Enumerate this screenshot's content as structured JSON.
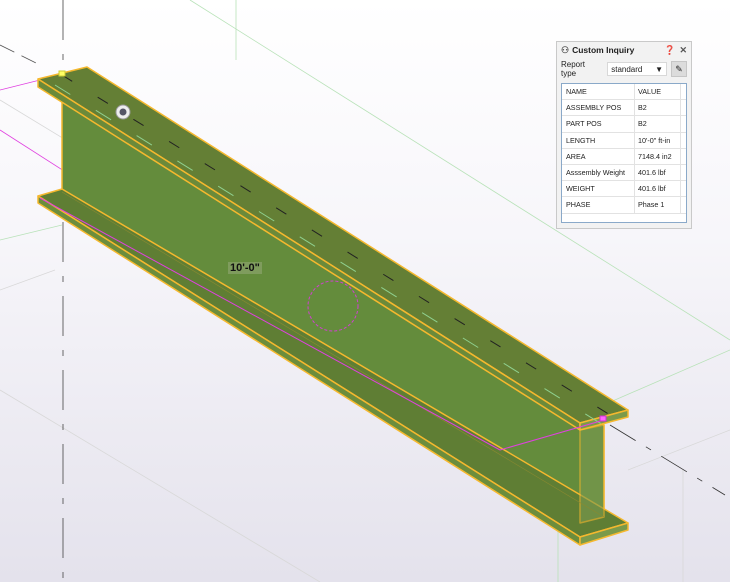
{
  "model": {
    "dimension_label": "10'-0\"",
    "beam_color": "#648a3a",
    "highlight_color": "#f5b82e"
  },
  "panel": {
    "title": "Custom Inquiry",
    "title_icon": "inquiry-icon",
    "help_icon": "help-icon",
    "close_icon": "close-icon",
    "report_type_label": "Report type",
    "report_type_value": "standard",
    "columns": [
      "NAME",
      "VALUE"
    ],
    "rows": [
      {
        "name": "ASSEMBLY POS",
        "value": "B2"
      },
      {
        "name": "PART POS",
        "value": "B2"
      },
      {
        "name": "LENGTH",
        "value": "10'-0\" ft-in"
      },
      {
        "name": "AREA",
        "value": "7148.4 in2"
      },
      {
        "name": "Asssembly Weight",
        "value": "401.6 lbf"
      },
      {
        "name": "WEIGHT",
        "value": "401.6 lbf"
      },
      {
        "name": "PHASE",
        "value": "Phase 1"
      }
    ]
  }
}
